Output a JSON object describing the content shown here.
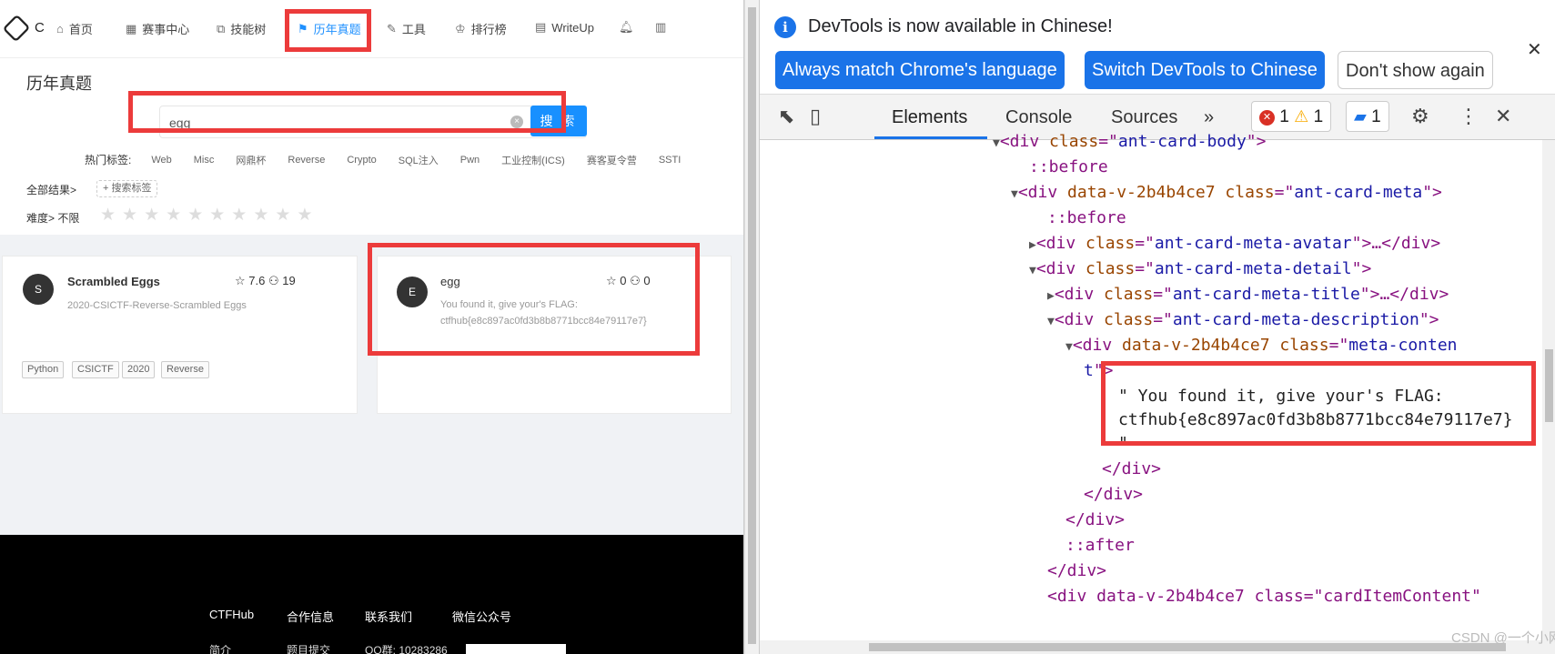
{
  "site": {
    "logo_text": "C",
    "nav": [
      {
        "label": "首页",
        "icon": "home-icon"
      },
      {
        "label": "赛事中心",
        "icon": "calendar-icon"
      },
      {
        "label": "技能树",
        "icon": "tree-icon"
      },
      {
        "label": "历年真题",
        "icon": "flag-icon",
        "active": true
      },
      {
        "label": "工具",
        "icon": "wrench-icon"
      },
      {
        "label": "排行榜",
        "icon": "trophy-icon"
      },
      {
        "label": "WriteUp",
        "icon": "book-icon"
      }
    ],
    "page_title": "历年真题",
    "search": {
      "value": "egg",
      "button": "搜 索"
    },
    "hot_tags_label": "热门标签:",
    "hot_tags": [
      "Web",
      "Misc",
      "网鼎杯",
      "Reverse",
      "Crypto",
      "SQL注入",
      "Pwn",
      "工业控制(ICS)",
      "赛客夏令营",
      "SSTI"
    ],
    "all_results": "全部结果>",
    "add_tag": "+ 搜索标签",
    "difficulty": "难度> 不限",
    "cards": [
      {
        "avatar": "S",
        "title": "Scrambled Eggs",
        "rating": "7.6",
        "solves": "19",
        "desc": "2020-CSICTF-Reverse-Scrambled Eggs",
        "tags": [
          "Python",
          "CSICTF",
          "2020",
          "Reverse"
        ]
      },
      {
        "avatar": "E",
        "title": "egg",
        "rating": "0",
        "solves": "0",
        "desc_line1": "You found it, give your's FLAG:",
        "desc_line2": "ctfhub{e8c897ac0fd3b8b8771bcc84e79117e7}"
      }
    ],
    "footer": {
      "headings": [
        "CTFHub",
        "合作信息",
        "联系我们",
        "微信公众号"
      ],
      "sub": [
        "简介",
        "题目提交",
        "QQ群: 10283286"
      ]
    }
  },
  "devtools": {
    "info_text": "DevTools is now available in Chinese!",
    "buttons": [
      "Always match Chrome's language",
      "Switch DevTools to Chinese",
      "Don't show again"
    ],
    "tabs": [
      "Elements",
      "Console",
      "Sources"
    ],
    "more_tabs": "»",
    "errors": "1",
    "warnings": "1",
    "messages": "1",
    "dom": {
      "l1_tag": "div",
      "l1_attr": "class",
      "l1_val": "ant-card-body",
      "before": "::before",
      "l3_attr1": "data-v-2b4b4ce7",
      "l3_attr2": "class",
      "l3_val": "ant-card-meta",
      "l5_val": "ant-card-meta-avatar",
      "l6_val": "ant-card-meta-detail",
      "l7_val": "ant-card-meta-title",
      "l8_val": "ant-card-meta-description",
      "l9_attr1": "data-v-2b4b4ce7",
      "l9_val_a": "meta-conten",
      "l9_val_b": "t",
      "text1": "\" You found it, give your's FLAG:",
      "text2": "ctfhub{e8c897ac0fd3b8b8771bcc84e79117e7}",
      "text3": "\"",
      "after": "::after",
      "last_line": "<div data-v-2b4b4ce7 class=\"cardItemContent\""
    },
    "watermark": "CSDN @一个小网工"
  },
  "colors": {
    "accent": "#1890ff",
    "highlight": "#ec3b3b",
    "devtools_blue": "#1a73e8"
  }
}
